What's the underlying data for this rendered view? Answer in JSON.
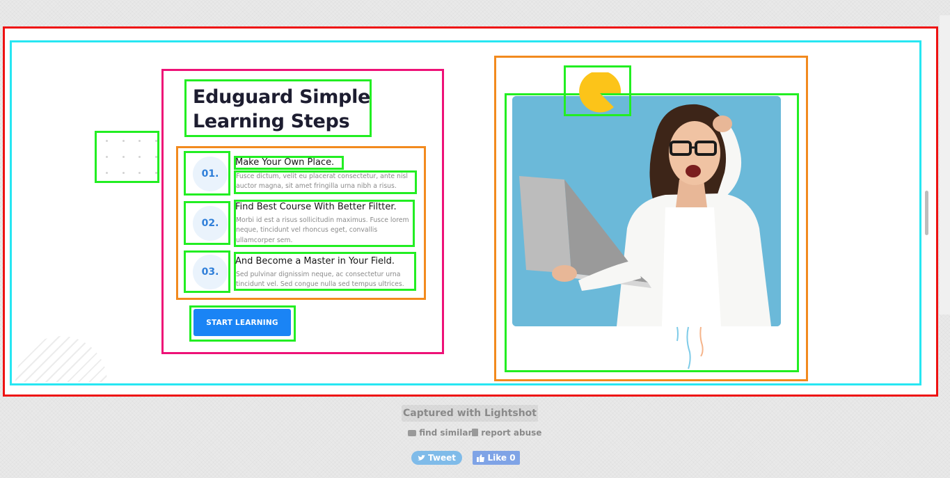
{
  "content": {
    "heading": "Eduguard Simple Learning Steps",
    "steps": [
      {
        "number": "01.",
        "title": "Make Your Own Place.",
        "description": "Fusce dictum, velit eu placerat consectetur, ante nisl auctor magna, sit amet fringilla urna nibh a risus."
      },
      {
        "number": "02.",
        "title": "Find Best Course With Better Filtter.",
        "description": "Morbi id est a risus sollicitudin maximus. Fusce lorem neque, tincidunt vel rhoncus eget, convallis ullamcorper sem."
      },
      {
        "number": "03.",
        "title": "And Become a Master in Your Field.",
        "description": "Sed pulvinar dignissim neque, ac consectetur urna tincidunt vel. Sed congue nulla sed tempus ultrices."
      }
    ],
    "cta_label": "START LEARNING"
  },
  "footer": {
    "caption": "Captured with Lightshot",
    "find_similar": "find similar",
    "report_abuse": "report abuse",
    "tweet_label": "Tweet",
    "like_label": "Like 0"
  },
  "icons": {
    "camera": "camera-icon",
    "report": "report-icon",
    "twitter": "twitter-bird-icon",
    "thumbs_up": "thumbs-up-icon"
  },
  "colors": {
    "outer_frame": "#ee1111",
    "inner_frame": "#27e6f2",
    "content_box": "#ee1177",
    "group_box": "#f28a1e",
    "element_box": "#22ee22",
    "primary_button": "#1a84f5",
    "accent_yellow": "#fcc419",
    "photo_background": "#6bb9d9"
  }
}
